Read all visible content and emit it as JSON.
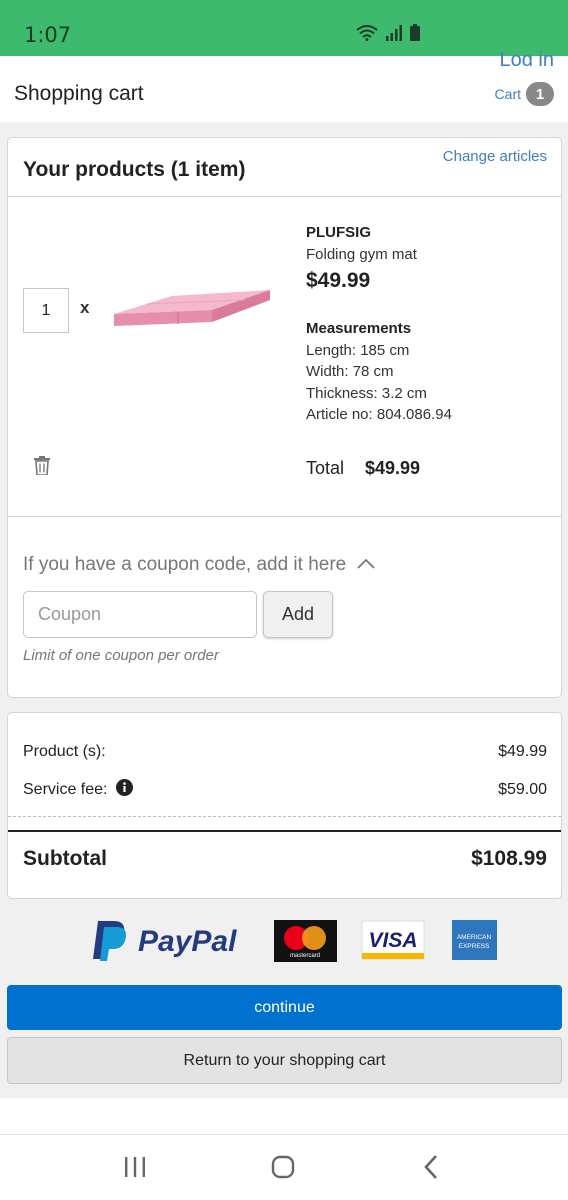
{
  "status_bar": {
    "time": "1:07",
    "color": "#3dba6d"
  },
  "header": {
    "login_label": "Log in",
    "title": "Shopping cart",
    "cart_label": "Cart",
    "cart_count": "1"
  },
  "products": {
    "title": "Your products (1 item)",
    "change_label": "Change articles",
    "item": {
      "quantity": "1",
      "times": "x",
      "brand": "PLUFSIG",
      "description": "Folding gym mat",
      "price": "$49.99",
      "measurements_title": "Measurements",
      "measurements": [
        "Length: 185 cm",
        "Width: 78 cm",
        "Thickness: 3.2 cm",
        "Article no: 804.086.94"
      ],
      "total_label": "Total",
      "total_value": "$49.99"
    }
  },
  "coupon": {
    "title": "If you have a coupon code, add it here",
    "placeholder": "Coupon",
    "add_label": "Add",
    "note": "Limit of one coupon per order"
  },
  "summary": {
    "products_label": "Product (s):",
    "products_value": "$49.99",
    "fee_label": "Service fee:",
    "fee_value": "$59.00",
    "subtotal_label": "Subtotal",
    "subtotal_value": "$108.99"
  },
  "payment": {
    "paypal": "PayPal",
    "mastercard": "mastercard",
    "visa": "VISA",
    "amex_top": "AMERICAN",
    "amex_bottom": "EXPRESS"
  },
  "buttons": {
    "continue": "continue",
    "return": "Return to your shopping cart"
  },
  "colors": {
    "accent": "#0071cf",
    "link": "#3f7fbf",
    "status_green": "#3dba6d"
  }
}
